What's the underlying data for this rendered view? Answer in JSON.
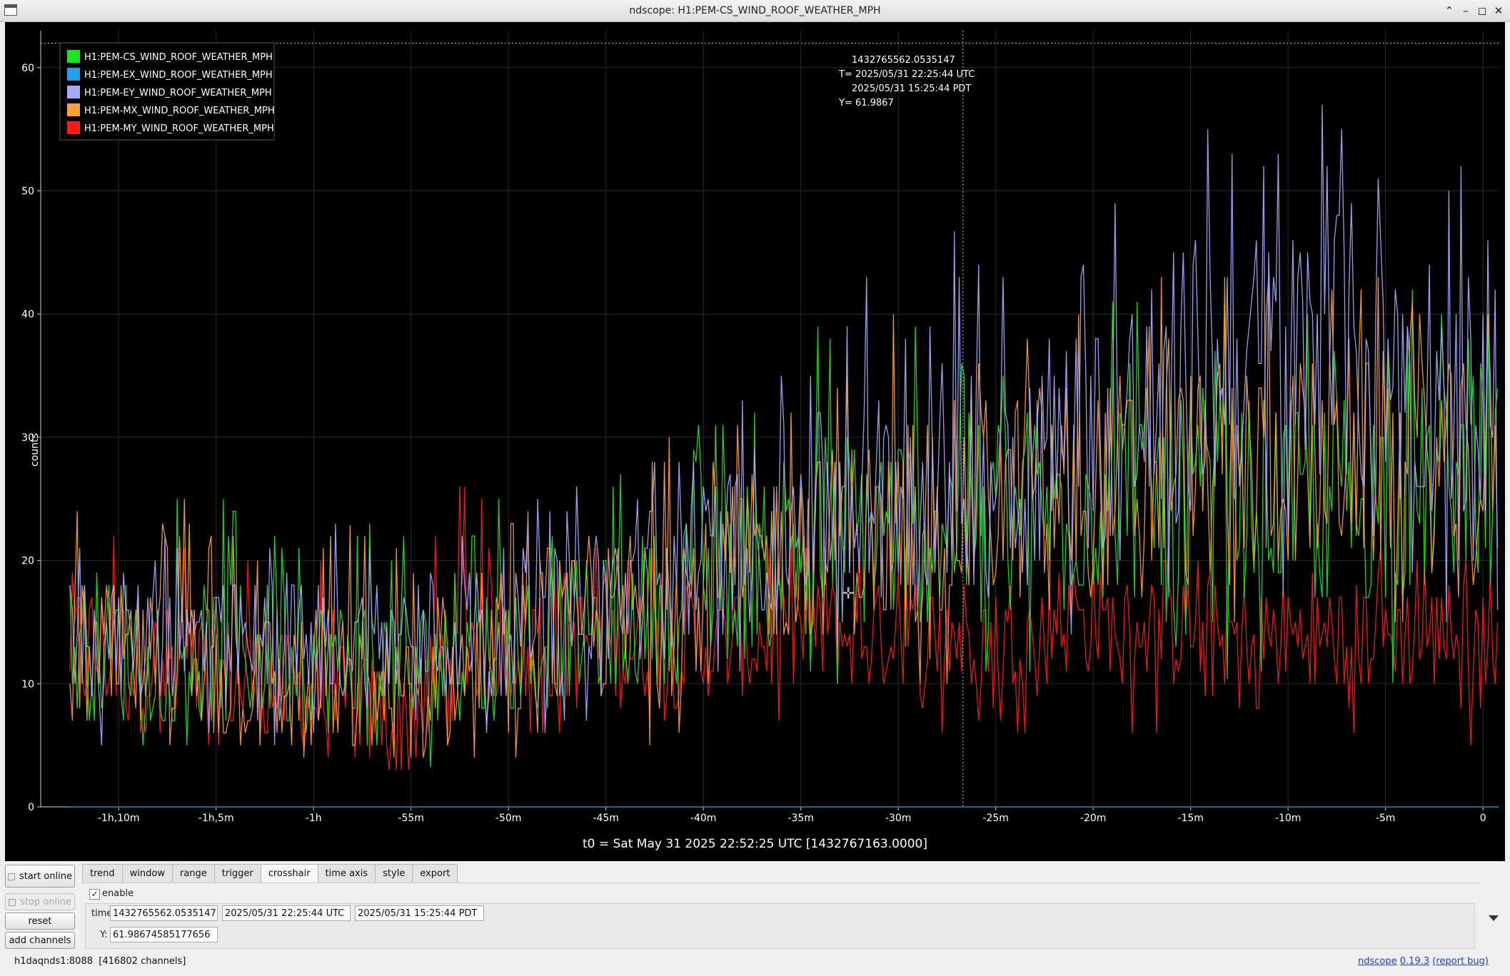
{
  "window": {
    "title": "ndscope: H1:PEM-CS_WIND_ROOF_WEATHER_MPH",
    "controls": [
      "minimize-up",
      "minimize",
      "maximize",
      "close"
    ]
  },
  "plot": {
    "background": "#000000",
    "ylabel": "counts",
    "t0_text": "t0 = Sat May 31 2025 22:52:25 UTC [1432767163.0000]",
    "legend": [
      {
        "label": "H1:PEM-CS_WIND_ROOF_WEATHER_MPH",
        "color": "#19e619"
      },
      {
        "label": "H1:PEM-EX_WIND_ROOF_WEATHER_MPH",
        "color": "#1ea0f0"
      },
      {
        "label": "H1:PEM-EY_WIND_ROOF_WEATHER_MPH",
        "color": "#a8a8ff"
      },
      {
        "label": "H1:PEM-MX_WIND_ROOF_WEATHER_MPH",
        "color": "#ff9f33"
      },
      {
        "label": "H1:PEM-MY_WIND_ROOF_WEATHER_MPH",
        "color": "#ff1a1a"
      }
    ],
    "crosshair_readout": {
      "gps": "1432765562.0535147",
      "utc": "T= 2025/05/31 22:25:44 UTC",
      "pdt": "2025/05/31 15:25:44 PDT",
      "y": "Y= 61.9867"
    }
  },
  "chart_data": {
    "type": "line",
    "ylabel": "counts",
    "xlabel": "",
    "ylim": [
      0,
      63
    ],
    "xlim_minutes": [
      -74,
      0.8
    ],
    "y_ticks": [
      "0",
      "10",
      "20",
      "30",
      "40",
      "50",
      "60"
    ],
    "x_ticks": [
      {
        "label": "-1h,10m",
        "value": -70
      },
      {
        "label": "-1h,5m",
        "value": -65
      },
      {
        "label": "-1h",
        "value": -60
      },
      {
        "label": "-55m",
        "value": -55
      },
      {
        "label": "-50m",
        "value": -50
      },
      {
        "label": "-45m",
        "value": -45
      },
      {
        "label": "-40m",
        "value": -40
      },
      {
        "label": "-35m",
        "value": -35
      },
      {
        "label": "-30m",
        "value": -30
      },
      {
        "label": "-25m",
        "value": -25
      },
      {
        "label": "-20m",
        "value": -20
      },
      {
        "label": "-15m",
        "value": -15
      },
      {
        "label": "-10m",
        "value": -10
      },
      {
        "label": "-5m",
        "value": -5
      },
      {
        "label": "0",
        "value": 0
      }
    ],
    "grid": true,
    "legend_position": "top-left",
    "crosshair": {
      "x_minutes": -26.68,
      "y": 61.9867
    },
    "series_start_minutes": -72.5,
    "series_step_minutes": 0.125,
    "series": [
      {
        "name": "H1:PEM-EX_WIND_ROOF_WEATHER_MPH",
        "color": "#1ea0f0",
        "keyframes": [
          [
            -72.5,
            0,
            0,
            0
          ],
          [
            0.8,
            0,
            0,
            0
          ]
        ]
      },
      {
        "name": "H1:PEM-MY_WIND_ROOF_WEATHER_MPH",
        "color": "#ff1a1a",
        "keyframes": [
          [
            -72.5,
            13,
            4,
            26
          ],
          [
            -60,
            9,
            3,
            20
          ],
          [
            -55,
            7,
            2,
            20
          ],
          [
            -52,
            15,
            5,
            29
          ],
          [
            -45,
            13,
            5,
            23
          ],
          [
            -40,
            13,
            5,
            22
          ],
          [
            -35,
            14,
            6,
            22
          ],
          [
            -30,
            14,
            5,
            22
          ],
          [
            -25,
            14,
            5,
            21
          ],
          [
            -20,
            15,
            6,
            21
          ],
          [
            -15,
            14,
            5,
            20
          ],
          [
            -10,
            14,
            5,
            21
          ],
          [
            -5,
            14,
            5,
            21
          ],
          [
            0.8,
            14,
            5,
            20
          ]
        ]
      },
      {
        "name": "H1:PEM-CS_WIND_ROOF_WEATHER_MPH",
        "color": "#19e619",
        "keyframes": [
          [
            -72.5,
            13,
            5,
            27
          ],
          [
            -60,
            12,
            4,
            25
          ],
          [
            -55,
            11,
            3,
            23
          ],
          [
            -50,
            13,
            4,
            26
          ],
          [
            -45,
            15,
            6,
            27
          ],
          [
            -40,
            18,
            7,
            32
          ],
          [
            -35,
            22,
            9,
            39
          ],
          [
            -30,
            23,
            9,
            40
          ],
          [
            -25,
            24,
            10,
            41
          ],
          [
            -20,
            25,
            10,
            42
          ],
          [
            -15,
            25,
            10,
            43
          ],
          [
            -10,
            25,
            11,
            41
          ],
          [
            -5,
            25,
            10,
            43
          ],
          [
            0.8,
            27,
            11,
            40
          ]
        ]
      },
      {
        "name": "H1:PEM-MX_WIND_ROOF_WEATHER_MPH",
        "color": "#ff9f33",
        "keyframes": [
          [
            -72.5,
            12,
            4,
            27
          ],
          [
            -60,
            10,
            2,
            24
          ],
          [
            -55,
            9,
            1,
            21
          ],
          [
            -50,
            12,
            3,
            24
          ],
          [
            -45,
            15,
            4,
            27
          ],
          [
            -42,
            17,
            5,
            36
          ],
          [
            -40,
            18,
            6,
            31
          ],
          [
            -35,
            21,
            8,
            36
          ],
          [
            -30,
            23,
            9,
            41
          ],
          [
            -25,
            25,
            10,
            42
          ],
          [
            -20,
            26,
            11,
            43
          ],
          [
            -15,
            27,
            11,
            44
          ],
          [
            -10,
            28,
            12,
            44
          ],
          [
            -5,
            28,
            12,
            44
          ],
          [
            0.8,
            27,
            12,
            42
          ]
        ]
      },
      {
        "name": "H1:PEM-EY_WIND_ROOF_WEATHER_MPH",
        "color": "#a8a8ff",
        "keyframes": [
          [
            -72.5,
            14,
            5,
            24
          ],
          [
            -60,
            13,
            4,
            23
          ],
          [
            -55,
            14,
            5,
            25
          ],
          [
            -50,
            15,
            5,
            26
          ],
          [
            -45,
            17,
            7,
            28
          ],
          [
            -40,
            20,
            9,
            32
          ],
          [
            -35,
            24,
            11,
            40
          ],
          [
            -30,
            26,
            12,
            45
          ],
          [
            -25,
            28,
            13,
            48
          ],
          [
            -20,
            30,
            14,
            50
          ],
          [
            -16,
            33,
            15,
            60
          ],
          [
            -15,
            35,
            16,
            58
          ],
          [
            -10,
            36,
            16,
            55
          ],
          [
            -8.5,
            38,
            17,
            62
          ],
          [
            -5,
            36,
            16,
            58
          ],
          [
            0.8,
            33,
            14,
            50
          ]
        ]
      }
    ]
  },
  "toolbar": {
    "start_online": "start online",
    "stop_online": "stop online",
    "reset": "reset",
    "add_channels": "add channels"
  },
  "tabs": [
    {
      "label": "trend",
      "active": false
    },
    {
      "label": "window",
      "active": false
    },
    {
      "label": "range",
      "active": false
    },
    {
      "label": "trigger",
      "active": false
    },
    {
      "label": "crosshair",
      "active": true
    },
    {
      "label": "time axis",
      "active": false
    },
    {
      "label": "style",
      "active": false
    },
    {
      "label": "export",
      "active": false
    }
  ],
  "crosshair_panel": {
    "enable_checked": true,
    "enable_label": "enable",
    "time_label": "time:",
    "time_gps": "1432765562.0535147",
    "time_utc": "2025/05/31 22:25:44 UTC",
    "time_pdt": "2025/05/31 15:25:44 PDT",
    "y_label": "Y:",
    "y_value": "61.98674585177656"
  },
  "status": {
    "server": "h1daqnds1:8088",
    "channels": "[416802 channels]",
    "app_name": "ndscope",
    "version": "0.19.3",
    "report_bug": "(report bug)"
  }
}
